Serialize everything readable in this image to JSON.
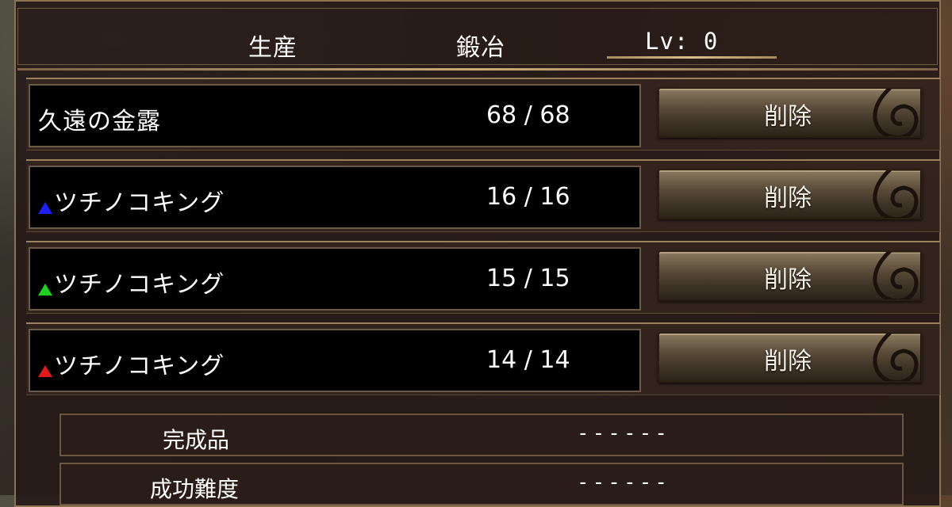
{
  "header": {
    "category": "生産",
    "skill": "鍛冶",
    "level": "Lv:  0"
  },
  "materials": [
    {
      "name": "久遠の金露",
      "marker": "",
      "qty": "68 / 68",
      "delete_label": "削除"
    },
    {
      "name": "ツチノコキング",
      "marker": "blue-triangle",
      "marker_color": "#1f1fff",
      "qty": "16 / 16",
      "delete_label": "削除"
    },
    {
      "name": "ツチノコキング",
      "marker": "green-triangle",
      "marker_color": "#1fd11f",
      "qty": "15 / 15",
      "delete_label": "削除"
    },
    {
      "name": "ツチノコキング",
      "marker": "red-triangle",
      "marker_color": "#e01a1a",
      "qty": "14 / 14",
      "delete_label": "削除"
    }
  ],
  "info": [
    {
      "label": "完成品",
      "value": "------"
    },
    {
      "label": "成功難度",
      "value": "------"
    }
  ]
}
